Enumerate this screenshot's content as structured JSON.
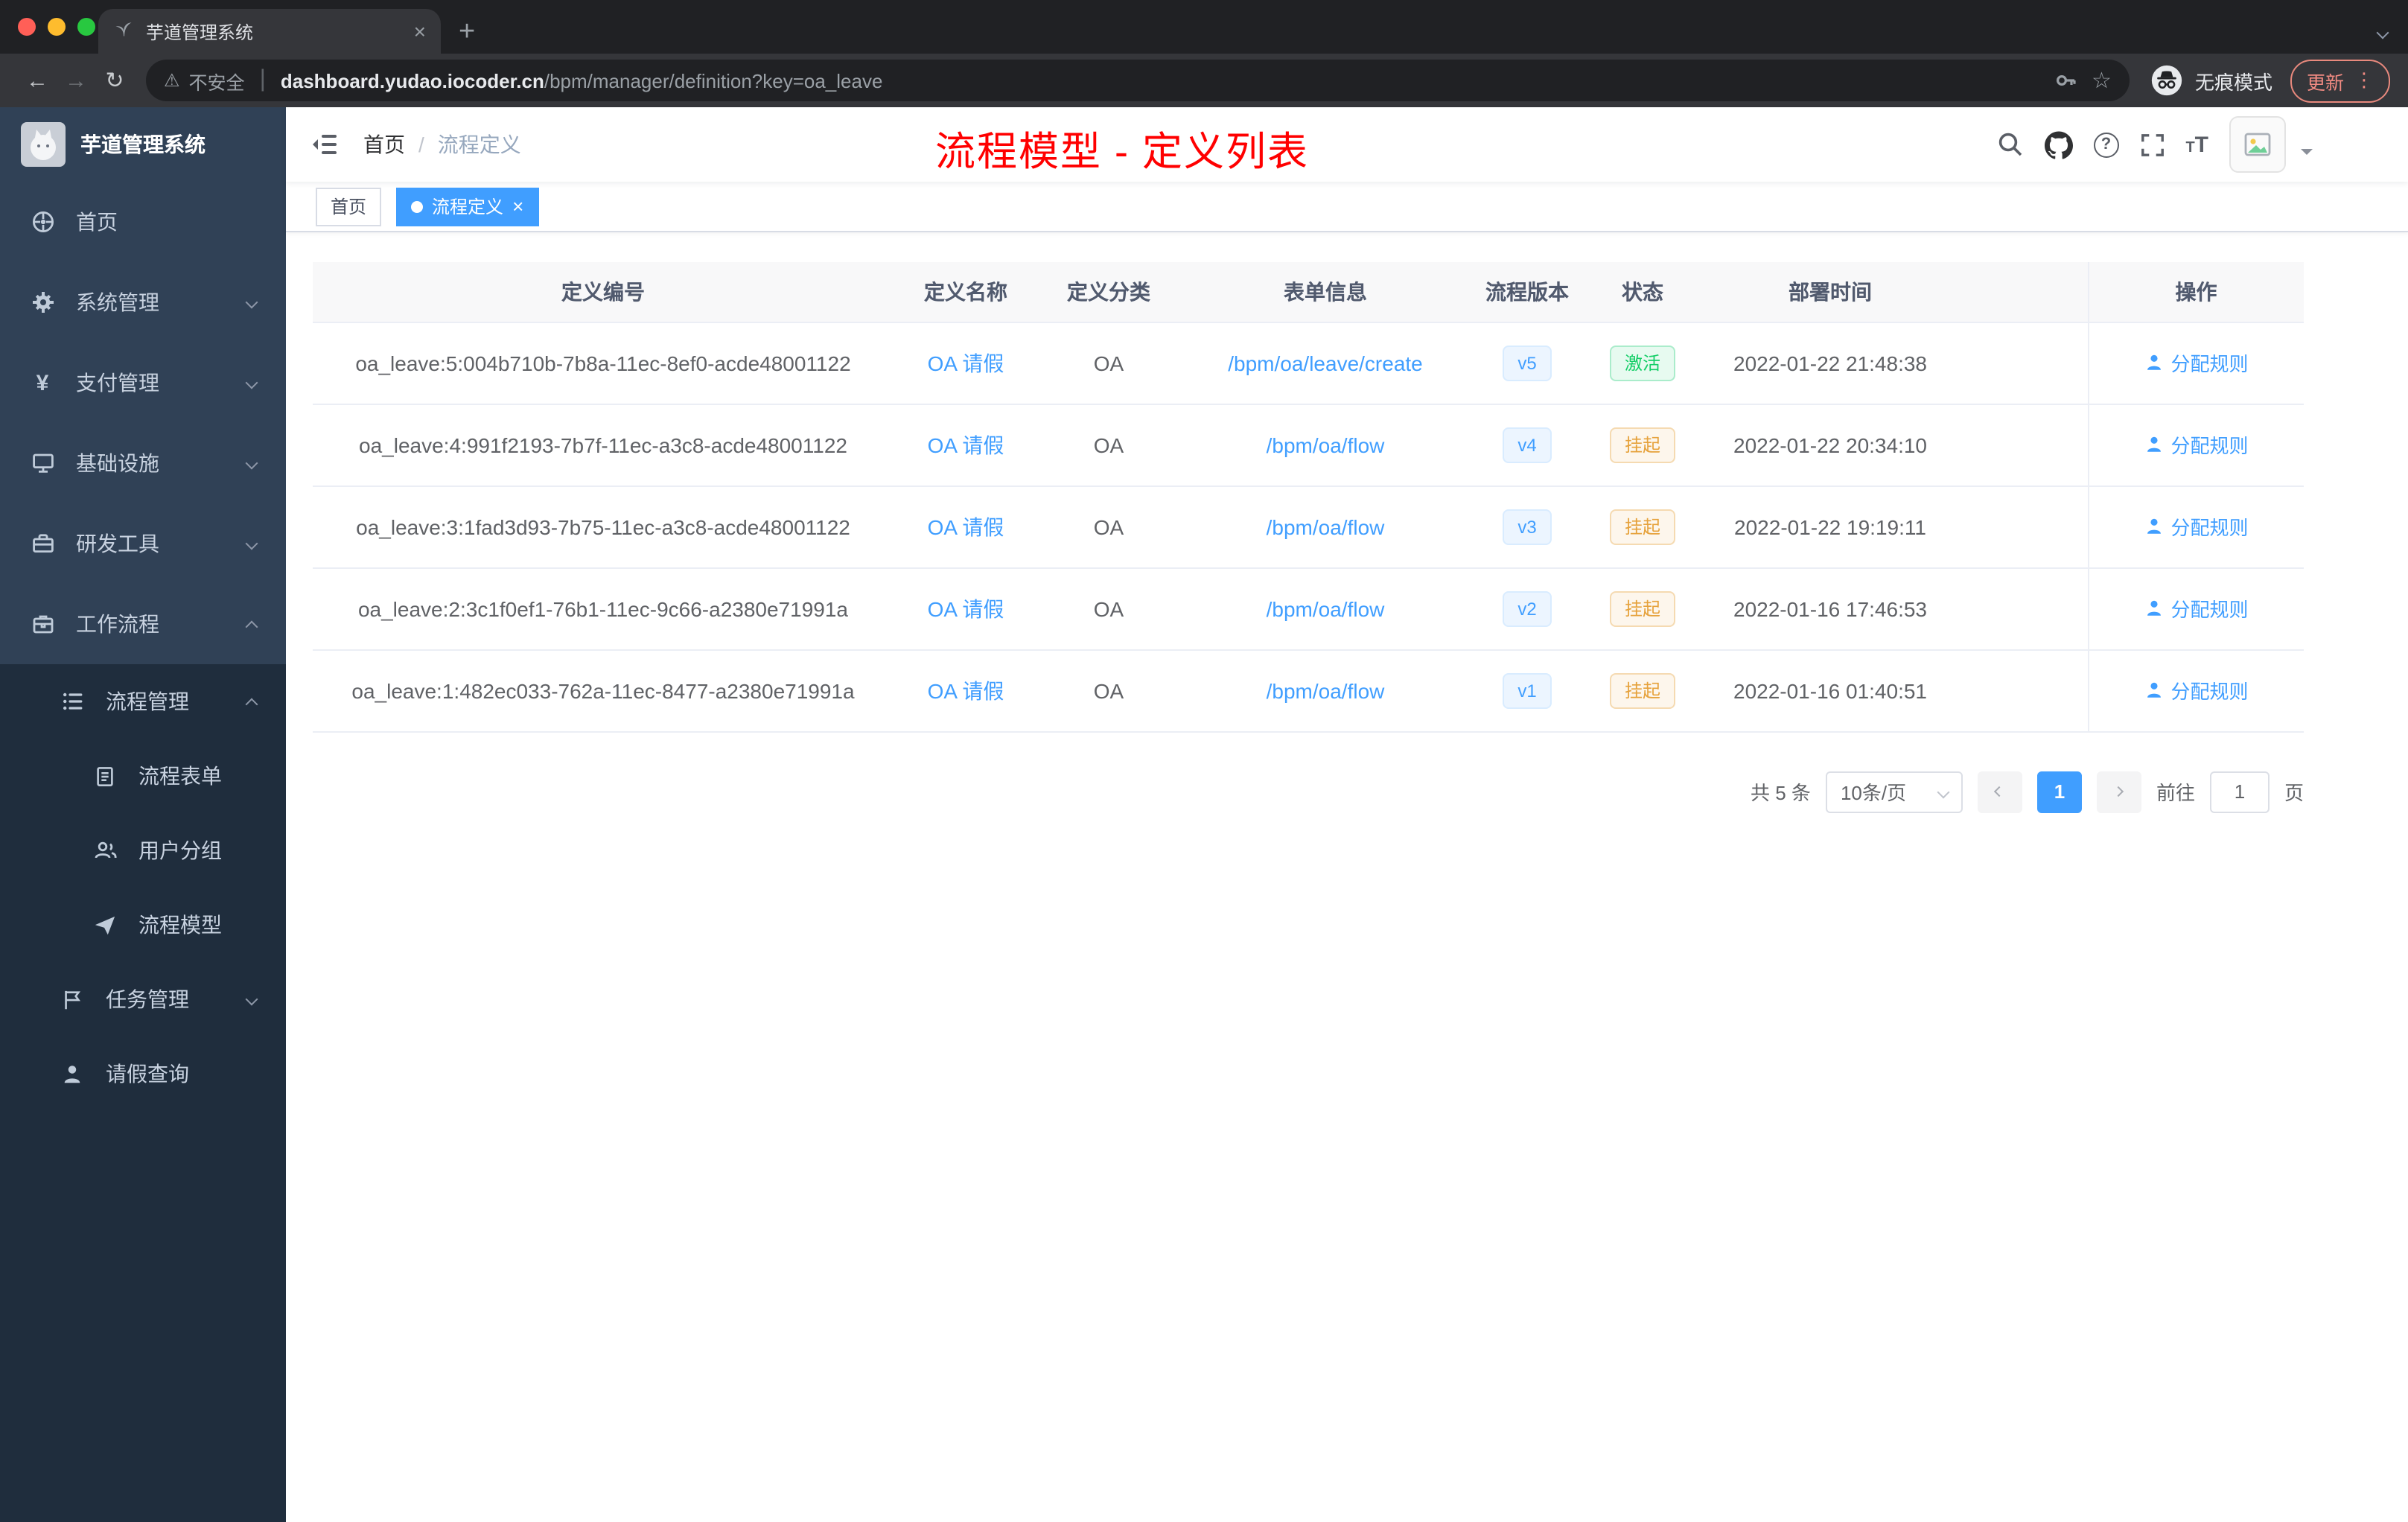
{
  "browser": {
    "tab_title": "芋道管理系统",
    "security_label": "不安全",
    "url_domain": "dashboard.yudao.iocoder.cn",
    "url_path": "/bpm/manager/definition?key=oa_leave",
    "incognito_label": "无痕模式",
    "update_label": "更新"
  },
  "sidebar": {
    "logo_title": "芋道管理系统",
    "menu": [
      {
        "label": "首页"
      },
      {
        "label": "系统管理"
      },
      {
        "label": "支付管理"
      },
      {
        "label": "基础设施"
      },
      {
        "label": "研发工具"
      },
      {
        "label": "工作流程"
      }
    ],
    "submenu": [
      {
        "label": "流程管理"
      },
      {
        "label": "流程表单"
      },
      {
        "label": "用户分组"
      },
      {
        "label": "流程模型"
      },
      {
        "label": "任务管理"
      },
      {
        "label": "请假查询"
      }
    ]
  },
  "header": {
    "breadcrumb_home": "首页",
    "breadcrumb_sep": "/",
    "breadcrumb_current": "流程定义",
    "overlay_title": "流程模型 - 定义列表"
  },
  "tags": {
    "home": "首页",
    "current": "流程定义"
  },
  "table": {
    "columns": [
      "定义编号",
      "定义名称",
      "定义分类",
      "表单信息",
      "流程版本",
      "状态",
      "部署时间",
      "操作"
    ],
    "rows": [
      {
        "id": "oa_leave:5:004b710b-7b8a-11ec-8ef0-acde48001122",
        "name": "OA 请假",
        "category": "OA",
        "form": "/bpm/oa/leave/create",
        "version": "v5",
        "status": "激活",
        "time": "2022-01-22 21:48:38",
        "action": "分配规则"
      },
      {
        "id": "oa_leave:4:991f2193-7b7f-11ec-a3c8-acde48001122",
        "name": "OA 请假",
        "category": "OA",
        "form": "/bpm/oa/flow",
        "version": "v4",
        "status": "挂起",
        "time": "2022-01-22 20:34:10",
        "action": "分配规则"
      },
      {
        "id": "oa_leave:3:1fad3d93-7b75-11ec-a3c8-acde48001122",
        "name": "OA 请假",
        "category": "OA",
        "form": "/bpm/oa/flow",
        "version": "v3",
        "status": "挂起",
        "time": "2022-01-22 19:19:11",
        "action": "分配规则"
      },
      {
        "id": "oa_leave:2:3c1f0ef1-76b1-11ec-9c66-a2380e71991a",
        "name": "OA 请假",
        "category": "OA",
        "form": "/bpm/oa/flow",
        "version": "v2",
        "status": "挂起",
        "time": "2022-01-16 17:46:53",
        "action": "分配规则"
      },
      {
        "id": "oa_leave:1:482ec033-762a-11ec-8477-a2380e71991a",
        "name": "OA 请假",
        "category": "OA",
        "form": "/bpm/oa/flow",
        "version": "v1",
        "status": "挂起",
        "time": "2022-01-16 01:40:51",
        "action": "分配规则"
      }
    ]
  },
  "pagination": {
    "total": "共 5 条",
    "page_size": "10条/页",
    "current_page": "1",
    "goto_label": "前往",
    "goto_value": "1",
    "page_unit": "页"
  },
  "colors": {
    "accent": "#409eff",
    "success": "#13ce66",
    "warning": "#e6a23c",
    "annotation": "#ff0000",
    "sidebar_bg": "#304156",
    "submenu_bg": "#1f2d3d"
  }
}
